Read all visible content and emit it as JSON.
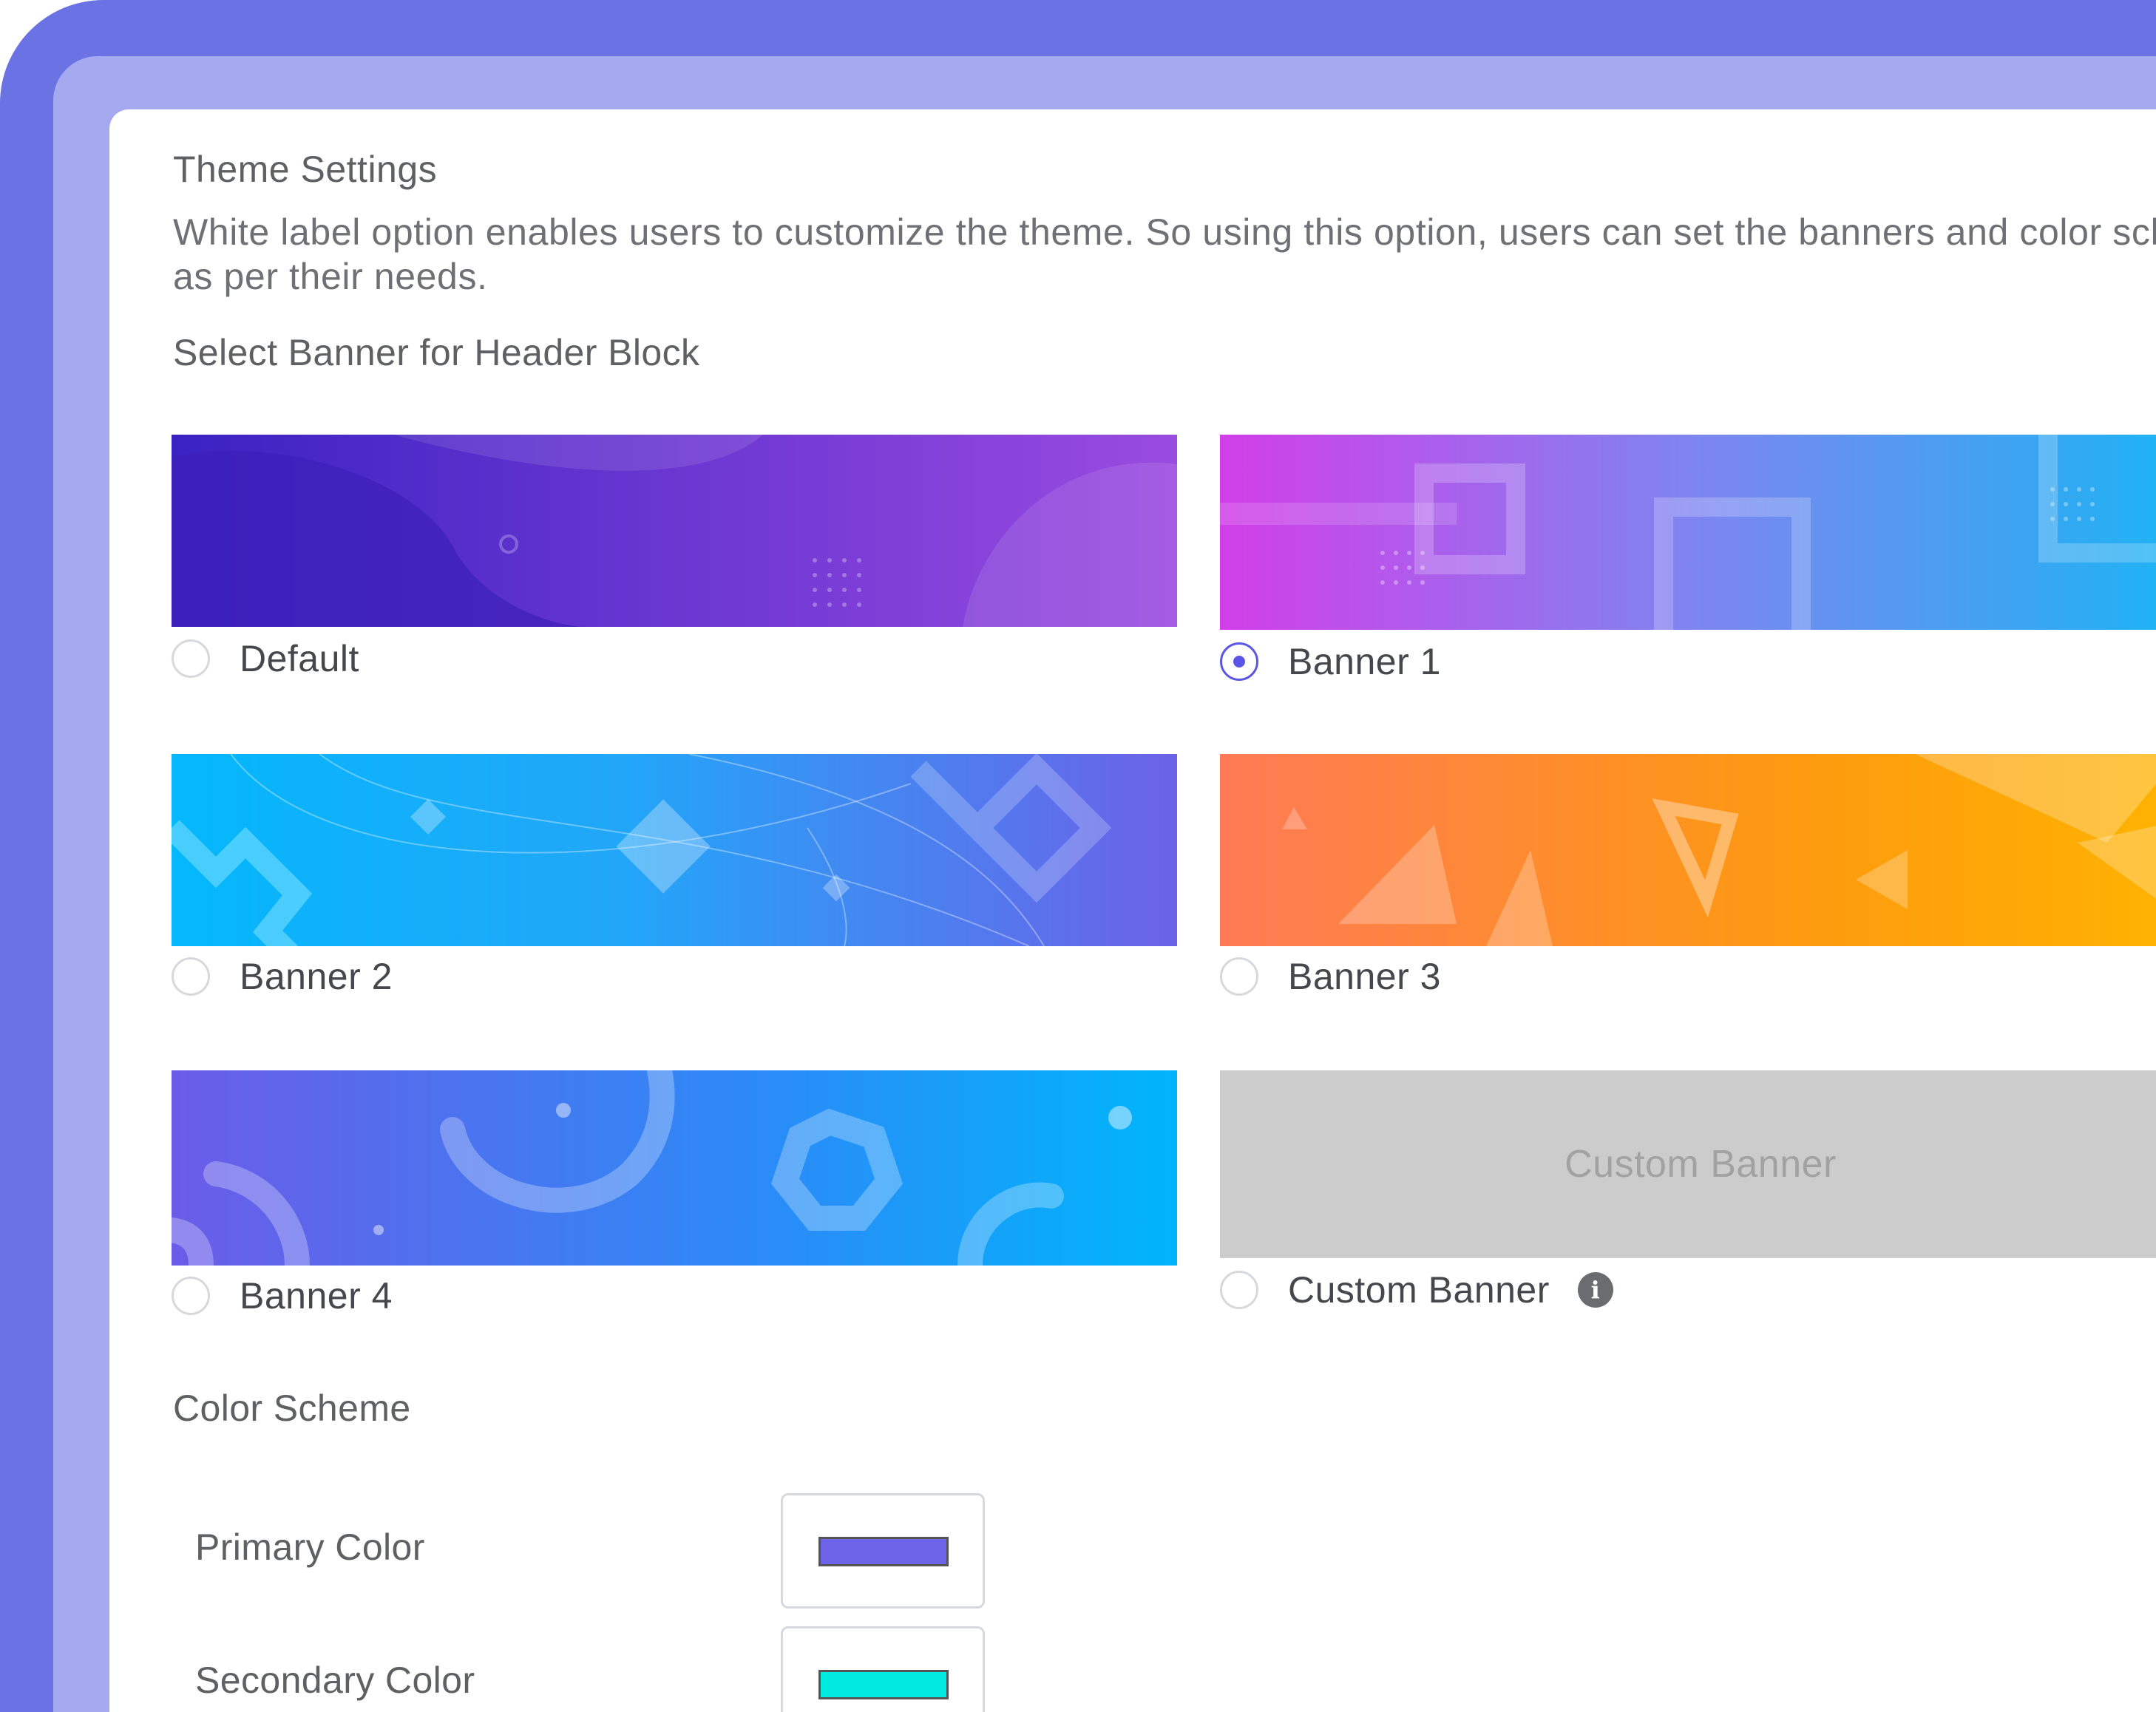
{
  "theme": {
    "title": "Theme Settings",
    "description": "White label option enables users to customize the theme. So using this option, users can set the banners and color scheme as per their needs.",
    "banner_section_label": "Select Banner for Header Block",
    "banners": [
      {
        "label": "Default",
        "selected": false
      },
      {
        "label": "Banner 1",
        "selected": true
      },
      {
        "label": "Banner 2",
        "selected": false
      },
      {
        "label": "Banner 3",
        "selected": false
      },
      {
        "label": "Banner 4",
        "selected": false
      },
      {
        "label": "Custom Banner",
        "selected": false,
        "placeholder": "Custom Banner",
        "icon": "info-icon"
      }
    ],
    "color_section_label": "Color Scheme",
    "colors": [
      {
        "label": "Primary Color",
        "value": "#6c63e8"
      },
      {
        "label": "Secondary Color",
        "value": "#00eadf"
      }
    ]
  },
  "accent": "#5b55e6"
}
